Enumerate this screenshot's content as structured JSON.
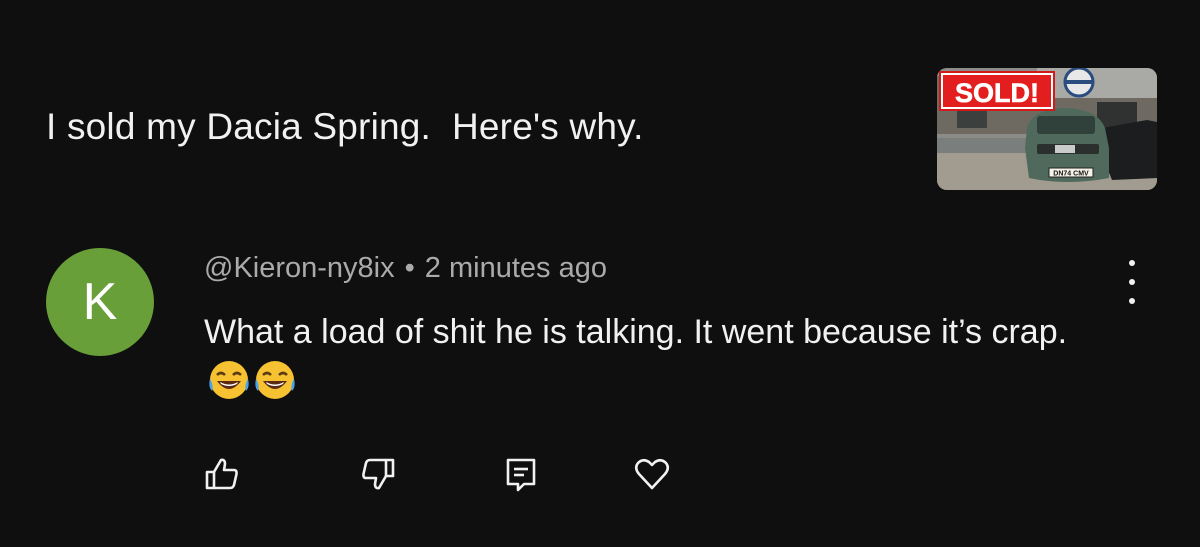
{
  "video": {
    "title": "I sold my Dacia Spring.  Here's why.",
    "thumbnail_badge": "SOLD!",
    "thumbnail_plate": "DN74 CMV"
  },
  "comment": {
    "avatar_letter": "K",
    "avatar_color": "#689f38",
    "author": "@Kieron-ny8ix",
    "separator": "•",
    "time": "2 minutes ago",
    "text": "What a load of shit he is talking.  It went because it’s crap.",
    "emojis": [
      "face-with-tears-of-joy",
      "face-with-tears-of-joy"
    ]
  },
  "actions": {
    "icons": [
      "thumbs-up-icon",
      "thumbs-down-icon",
      "reply-icon",
      "heart-icon"
    ]
  },
  "colors": {
    "background": "#0f0f0f",
    "text": "#f1f1f1",
    "secondary_text": "#aaaaaa"
  }
}
